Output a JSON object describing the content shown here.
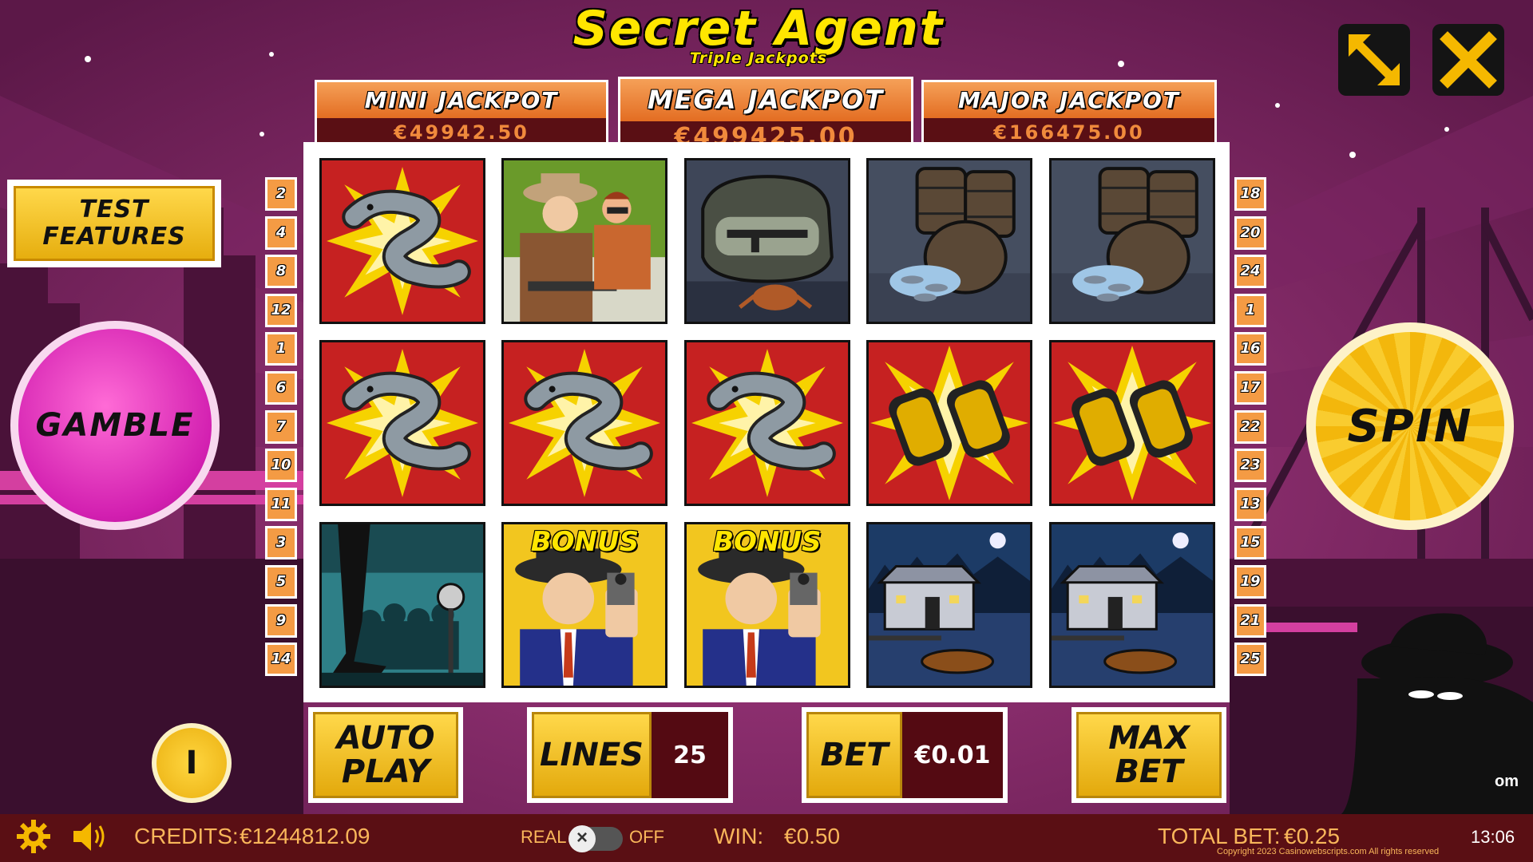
{
  "game": {
    "title": "Secret Agent",
    "subtitle": "Triple Jackpots"
  },
  "jackpots": {
    "mini": {
      "label": "MINI JACKPOT",
      "value": "€49942.50"
    },
    "mega": {
      "label": "MEGA JACKPOT",
      "value": "€499425.00"
    },
    "major": {
      "label": "MAJOR JACKPOT",
      "value": "€166475.00"
    }
  },
  "left_lines": [
    "2",
    "4",
    "8",
    "12",
    "1",
    "6",
    "7",
    "10",
    "11",
    "3",
    "5",
    "9",
    "14"
  ],
  "right_lines": [
    "18",
    "20",
    "24",
    "1",
    "16",
    "17",
    "22",
    "23",
    "13",
    "15",
    "19",
    "21",
    "25"
  ],
  "reels": [
    [
      "eel",
      "gangsters",
      "gun-case",
      "barrels",
      "barrels"
    ],
    [
      "eel",
      "eel",
      "eel",
      "binoculars",
      "binoculars"
    ],
    [
      "stage",
      "bonus-agent",
      "bonus-agent",
      "boathouse",
      "boathouse"
    ]
  ],
  "bonus_label": "BONUS",
  "buttons": {
    "test_features": "TEST FEATURES",
    "gamble": "GAMBLE",
    "spin": "SPIN",
    "info": "I",
    "auto_play": "AUTO PLAY",
    "max_bet": "MAX BET",
    "fullscreen_icon": "expand-arrows-icon",
    "close_icon": "close-x-icon"
  },
  "lines": {
    "label": "LINES",
    "value": "25"
  },
  "bet": {
    "label": "BET",
    "value": "€0.01"
  },
  "status": {
    "credits_label": "CREDITS:",
    "credits_value": "€1244812.09",
    "real_label": "REAL",
    "off_label": "OFF",
    "win_label": "WIN:",
    "win_value": "€0.50",
    "total_bet_label": "TOTAL BET:",
    "total_bet_value": "€0.25",
    "clock": "13:06",
    "copyright": "Copyright 2023 Casinowebscripts.com All rights reserved",
    "domain_fragment": "om"
  },
  "colors": {
    "accent_yellow": "#ffe600",
    "jackpot_orange": "#e36d22",
    "panel_maroon": "#5a0f14",
    "gamble_pink": "#d21fb0",
    "status_text": "#f9b65a"
  }
}
